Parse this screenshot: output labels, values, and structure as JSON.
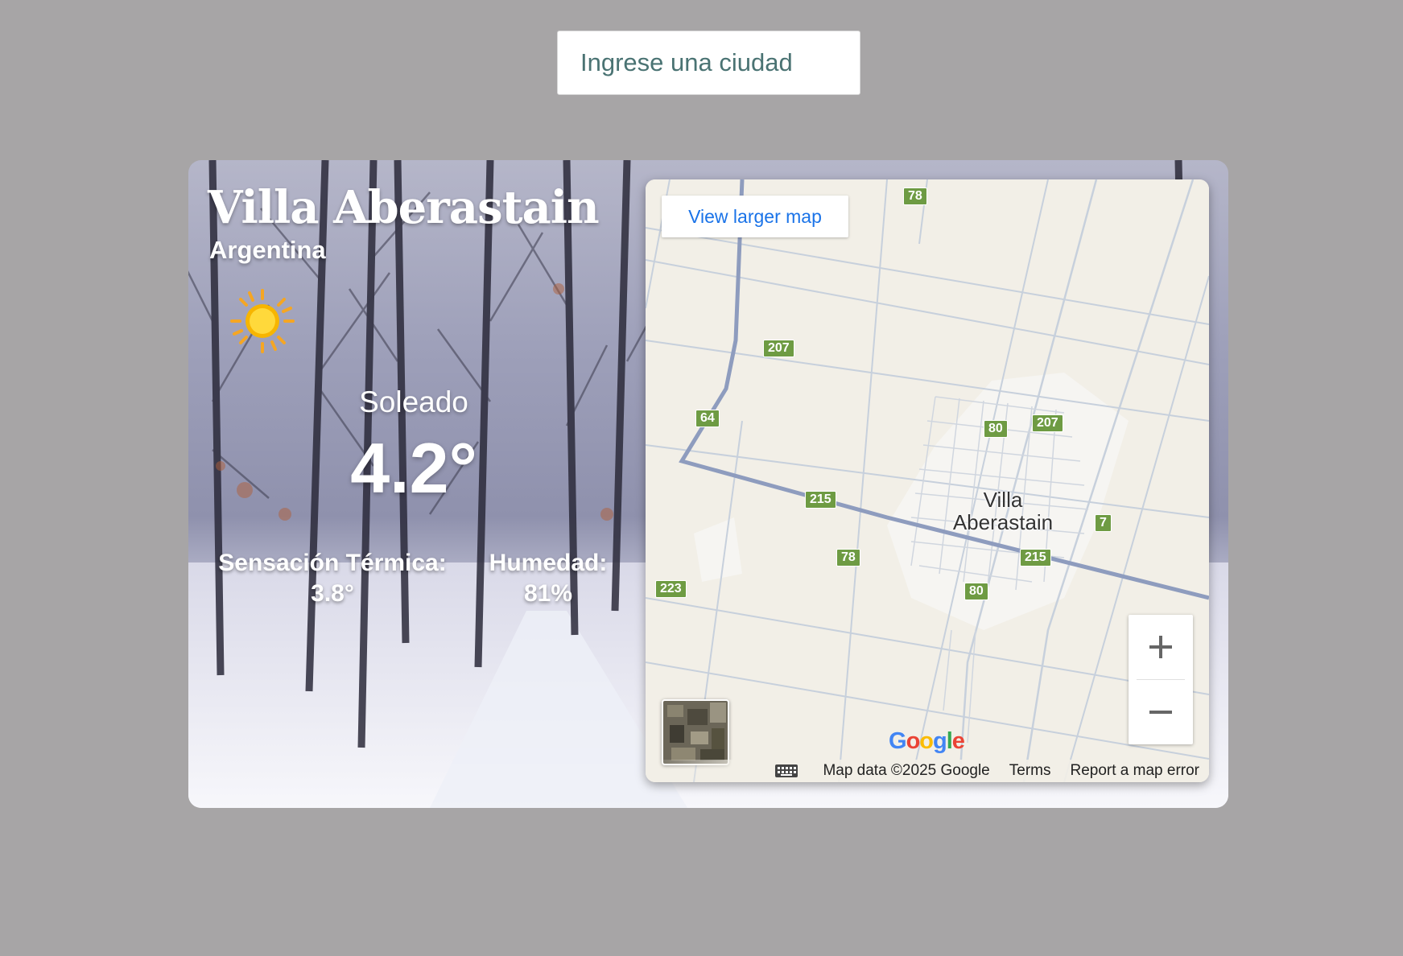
{
  "search": {
    "placeholder": "Ingrese una ciudad"
  },
  "weather": {
    "city": "Villa Aberastain",
    "country": "Argentina",
    "condition": "Soleado",
    "temperature": "4.2°",
    "feels_like_label": "Sensación Térmica:",
    "feels_like_value": "3.8°",
    "humidity_label": "Humedad:",
    "humidity_value": "81%",
    "icon": "sun-icon"
  },
  "map": {
    "view_larger": "View larger map",
    "town_line1": "Villa",
    "town_line2": "Aberastain",
    "shields": [
      "78",
      "207",
      "64",
      "215",
      "80",
      "207",
      "7",
      "78",
      "215",
      "223",
      "80"
    ],
    "zoom_in": "+",
    "zoom_out": "−",
    "logo": "Google",
    "attribution": "Map data ©2025 Google",
    "terms": "Terms",
    "report": "Report a map error"
  },
  "colors": {
    "page_bg": "#a7a5a6",
    "map_land": "#f2efe7",
    "shield": "#6e9b43",
    "link": "#1a73e8"
  }
}
